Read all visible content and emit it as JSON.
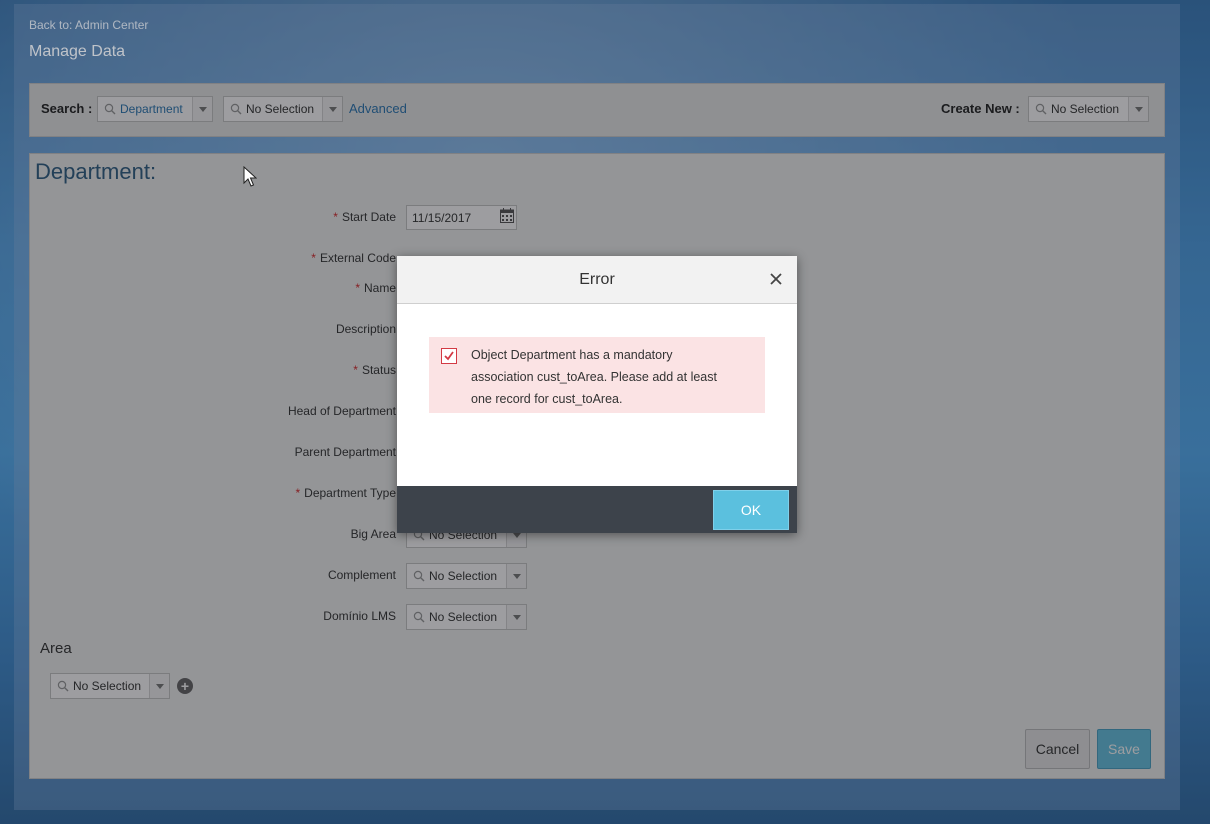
{
  "header": {
    "back_link": "Back to: Admin Center",
    "title": "Manage Data"
  },
  "search": {
    "label": "Search :",
    "object_value": "Department",
    "record_value": "No Selection",
    "advanced_label": "Advanced",
    "create_new_label": "Create New :",
    "create_new_value": "No Selection"
  },
  "form": {
    "section_title": "Department:",
    "fields": {
      "start_date": {
        "label": "Start Date",
        "value": "11/15/2017"
      },
      "external_code": {
        "label": "External Code"
      },
      "name": {
        "label": "Name"
      },
      "description": {
        "label": "Description"
      },
      "status": {
        "label": "Status"
      },
      "head_of_department": {
        "label": "Head of Department"
      },
      "parent_department": {
        "label": "Parent Department"
      },
      "department_type": {
        "label": "Department Type"
      },
      "big_area": {
        "label": "Big Area",
        "value": "No Selection"
      },
      "complement": {
        "label": "Complement",
        "value": "No Selection"
      },
      "dominio_lms": {
        "label": "Domínio LMS",
        "value": "No Selection"
      }
    },
    "required_marker": "*",
    "area": {
      "title": "Area",
      "value": "No Selection"
    },
    "cancel_label": "Cancel",
    "save_label": "Save"
  },
  "dialog": {
    "title": "Error",
    "message": "Object Department has a mandatory association cust_toArea. Please add at least one record for cust_toArea.",
    "ok_label": "OK"
  },
  "colors": {
    "accent_blue": "#5bc0de",
    "link_blue": "#2a77b5",
    "error_bg": "#fbe3e4",
    "required_red": "#d9282b",
    "footer_dark": "#3d434b"
  }
}
